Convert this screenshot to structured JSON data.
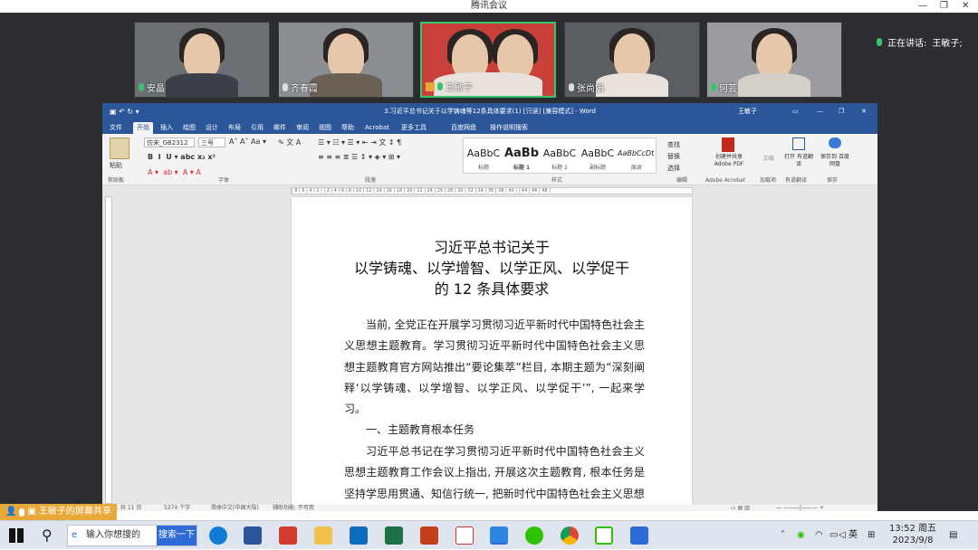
{
  "app": {
    "title": "腾讯会议"
  },
  "meeting": {
    "participants": [
      {
        "name": "安晶",
        "mic": "on"
      },
      {
        "name": "齐春霞",
        "mic": "muted"
      },
      {
        "name": "王敏子",
        "mic": "on",
        "active": true
      },
      {
        "name": "张尚娟",
        "mic": "muted"
      },
      {
        "name": "何芸",
        "mic": "on"
      }
    ],
    "speaking_label": "正在讲话:",
    "speaking_name": "王敏子;",
    "share_banner": "王敏子的屏幕共享"
  },
  "word": {
    "doc_title": "3.习近平总书记关于以学铸魂等12条具体要求(1) [只读] [兼容模式] - Word",
    "user": "王敏子",
    "tabs": [
      "文件",
      "开始",
      "插入",
      "绘图",
      "设计",
      "布局",
      "引用",
      "邮件",
      "审阅",
      "视图",
      "帮助",
      "Acrobat",
      "更多工具",
      "百度网盘",
      "操作说明搜索"
    ],
    "active_tab": "开始",
    "ribbon": {
      "paste": "粘贴",
      "clipboard": "剪贴板",
      "font_name": "仿宋_GB2312",
      "font_size": "三号",
      "font_group": "字体",
      "para_group": "段落",
      "styles_group": "样式",
      "styles": [
        {
          "sample": "AaBbC",
          "label": "标题"
        },
        {
          "sample": "AaBb",
          "label": "标题 1"
        },
        {
          "sample": "AaBbC",
          "label": "标题 2"
        },
        {
          "sample": "AaBbC",
          "label": "副标题"
        },
        {
          "sample": "AaBbCcDt",
          "label": "强调"
        }
      ],
      "find": "查找",
      "replace": "替换",
      "select": "选择",
      "edit_group": "编辑",
      "acrobat_btn": "创建并共享 Adobe PDF",
      "acrobat_group": "Adobe Acrobat",
      "ai_btn": "加载",
      "ai_group": "加载项",
      "translate_btn": "打开 有道翻译",
      "translate_group": "有道翻译",
      "save_btn": "保存到 百度网盘",
      "save_group": "保存"
    },
    "ruler": "| 8 | 6 | 4 | 2 |   | 2 | 4 | 6 | 8 | 10 | 12 | 14 | 16 | 18 | 20 | 22 | 24 | 26 | 28 | 30 | 32 | 34 | 36 | 38 | 40 |   | 44 | 46 | 48 |",
    "document": {
      "title_line1": "习近平总书记关于",
      "title_line2": "以学铸魂、以学增智、以学正风、以学促干",
      "title_line3": "的 12 条具体要求",
      "para1": "当前, 全党正在开展学习贯彻习近平新时代中国特色社会主义思想主题教育。学习贯彻习近平新时代中国特色社会主义思想主题教育官方网站推出“要论集萃”栏目, 本期主题为“深刻阐释‘以学铸魂、以学增智、以学正风、以学促干’”, 一起来学习。",
      "heading1": "一、主题教育根本任务",
      "para2": "习近平总书记在学习贯彻习近平新时代中国特色社会主义思想主题教育工作会议上指出, 开展这次主题教育, 根本任务是坚持学思用贯通、知信行统一, 把新时代中国特色社会主义思想"
    },
    "status": {
      "pages": "页面: 共 11 页",
      "words": "5274 个字",
      "lang": "简体中文(中国大陆)",
      "access": "辅助功能: 不可用"
    }
  },
  "taskbar": {
    "search_placeholder": "输入你想搜的",
    "search_button": "搜索一下",
    "ime": "英",
    "time": "13:52 周五",
    "date": "2023/9/8"
  }
}
